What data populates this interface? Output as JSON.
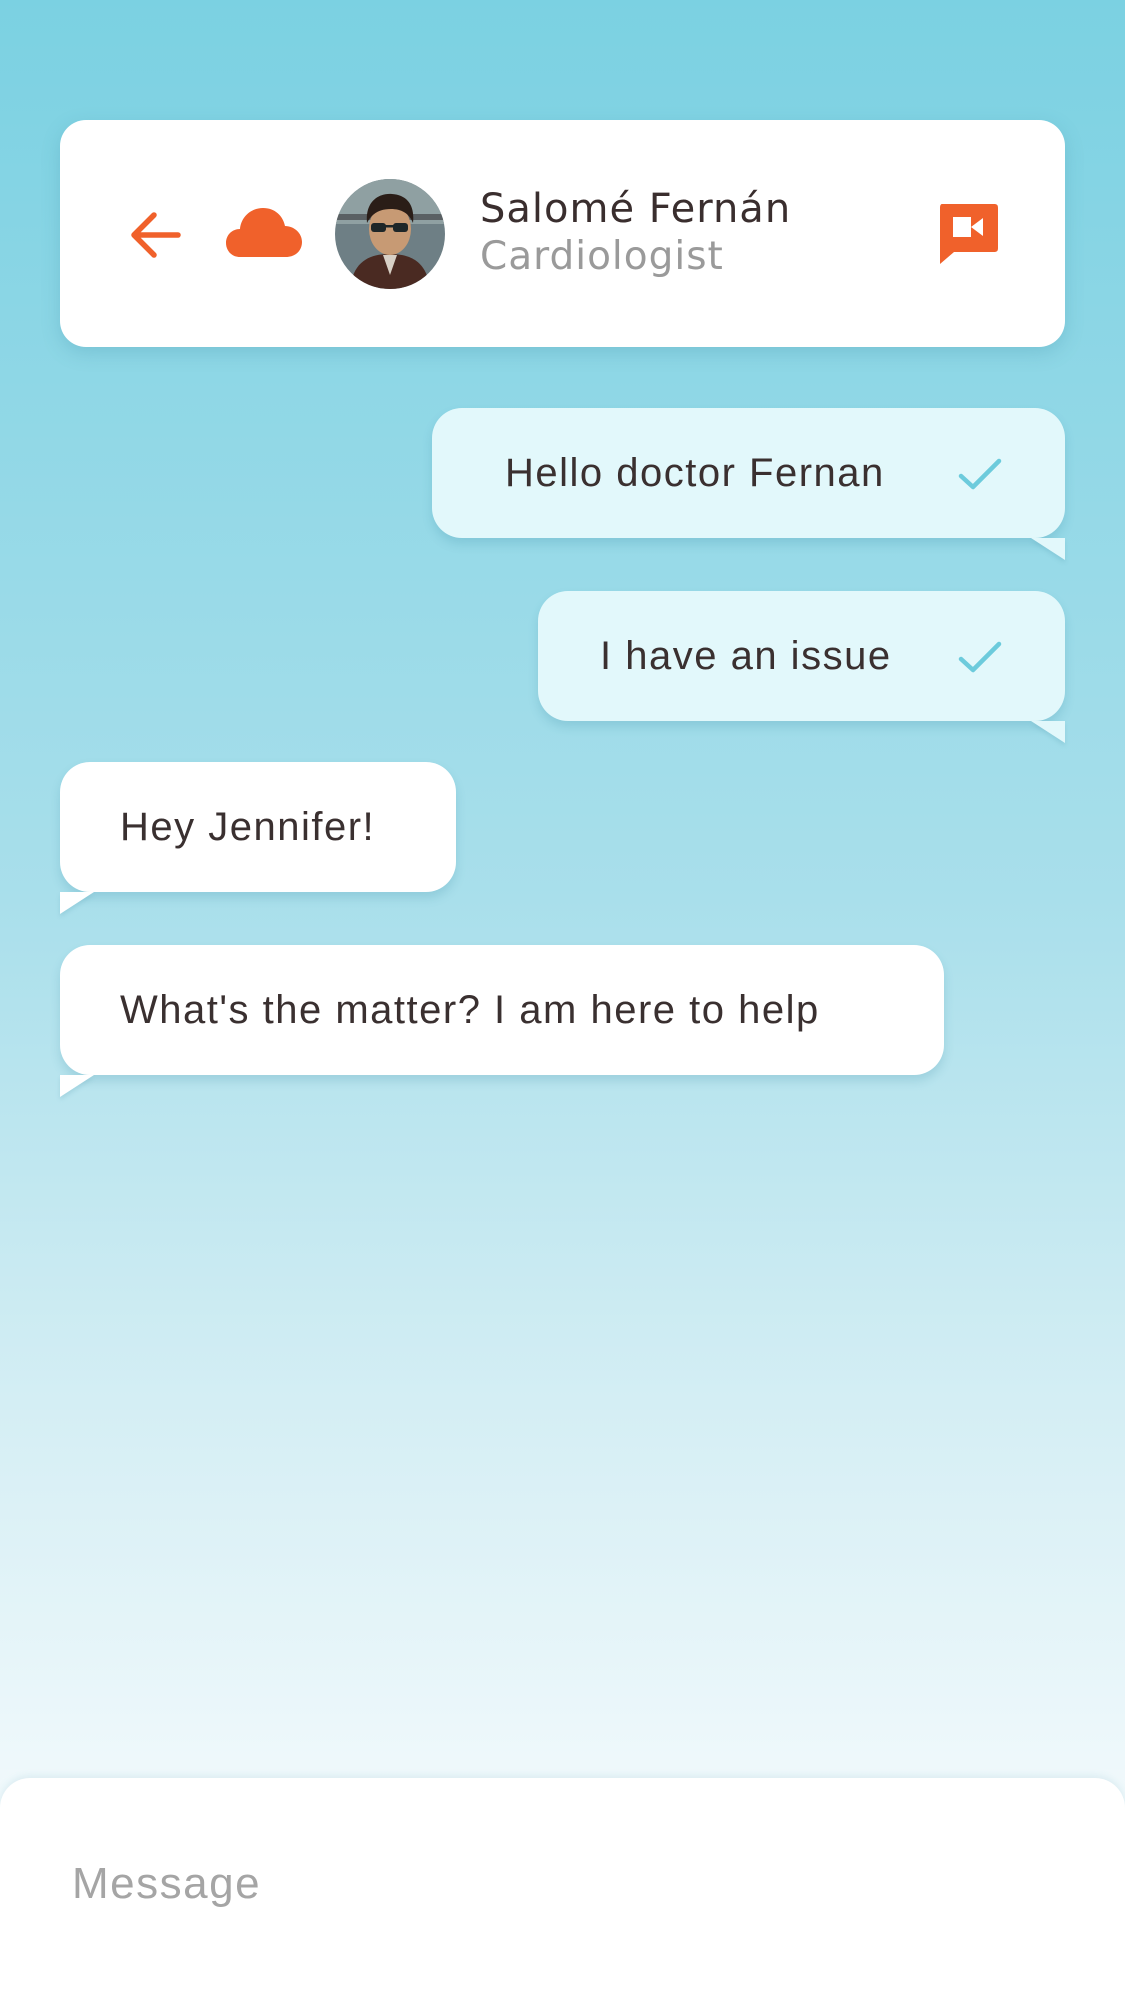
{
  "header": {
    "doctor_name": "Salomé Fernán",
    "doctor_role": "Cardiologist",
    "icons": [
      "arrow-left-icon",
      "cloud-icon",
      "video-camera-icon"
    ]
  },
  "messages": [
    {
      "direction": "outgoing",
      "text": "Hello doctor Fernan",
      "status": "sent"
    },
    {
      "direction": "outgoing",
      "text": "I have an issue",
      "status": "sent"
    },
    {
      "direction": "incoming",
      "text": "Hey Jennifer!"
    },
    {
      "direction": "incoming",
      "text": "What's the matter? I am here to help"
    }
  ],
  "composer": {
    "placeholder": "Message",
    "value": ""
  },
  "colors": {
    "accent": "#f0612b",
    "check": "#6ccbdc",
    "outgoing_bubble": "#e2f8fb",
    "incoming_bubble": "#ffffff",
    "background_top": "#7bd1e2"
  }
}
